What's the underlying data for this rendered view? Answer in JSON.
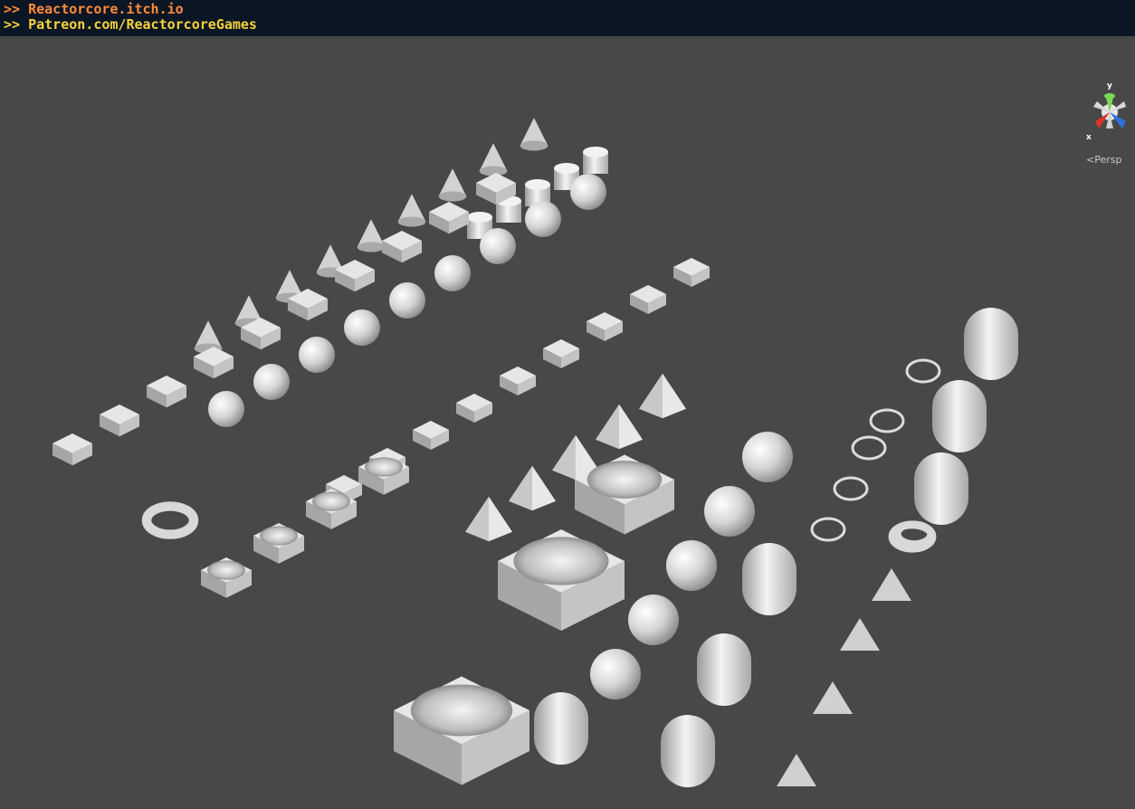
{
  "banner": {
    "line1": ">> Reactorcore.itch.io",
    "line2": ">> Patreon.com/ReactorcoreGames"
  },
  "viewport": {
    "projection_label": "Persp",
    "gizmo": {
      "axis_y": "y",
      "axis_x": "x"
    }
  },
  "colors": {
    "background": "#484848",
    "banner_bg": "#0b1624",
    "link1": "#ff8c3a",
    "link2": "#f5d13c",
    "gizmo_y": "#7ed957",
    "gizmo_x": "#d9342b",
    "gizmo_z": "#2f6fd9"
  },
  "scene": {
    "shapes": [
      "cone",
      "cone",
      "cone",
      "cone",
      "cone",
      "cone",
      "cone",
      "cone",
      "cone",
      "cylinder",
      "cylinder",
      "cylinder",
      "cylinder",
      "cylinder",
      "sphere",
      "sphere",
      "sphere",
      "sphere",
      "sphere",
      "sphere",
      "sphere",
      "sphere",
      "sphere",
      "sphere",
      "cube",
      "cube",
      "cube",
      "cube",
      "cube",
      "pyramid",
      "pyramid",
      "pyramid",
      "torus",
      "torus",
      "bowl",
      "bowl",
      "bowl",
      "ring",
      "ring",
      "pipe",
      "pipe",
      "pipe"
    ]
  }
}
